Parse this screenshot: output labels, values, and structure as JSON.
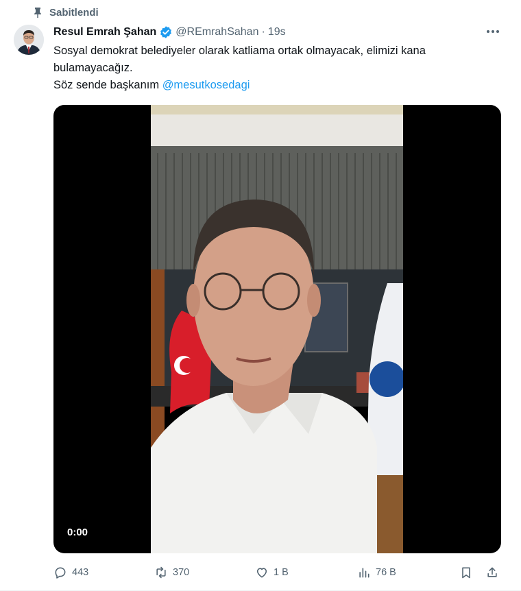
{
  "pinned": {
    "label": "Sabitlendi"
  },
  "tweet": {
    "author_name": "Resul Emrah Şahan",
    "handle": "@REmrahSahan",
    "separator": "·",
    "time": "19s",
    "text_line1": "Sosyal demokrat belediyeler olarak katliama ortak olmayacak, elimizi kana",
    "text_line2": "bulamayacağız.",
    "text_line3_prefix": "Söz sende başkanım ",
    "mention": "@mesutkosedagi"
  },
  "video": {
    "timecode": "0:00"
  },
  "actions": {
    "replies": "443",
    "reposts": "370",
    "likes": "1 B",
    "views": "76 B"
  },
  "colors": {
    "accent": "#1d9bf0",
    "muted": "#536471",
    "text": "#0f1419"
  }
}
